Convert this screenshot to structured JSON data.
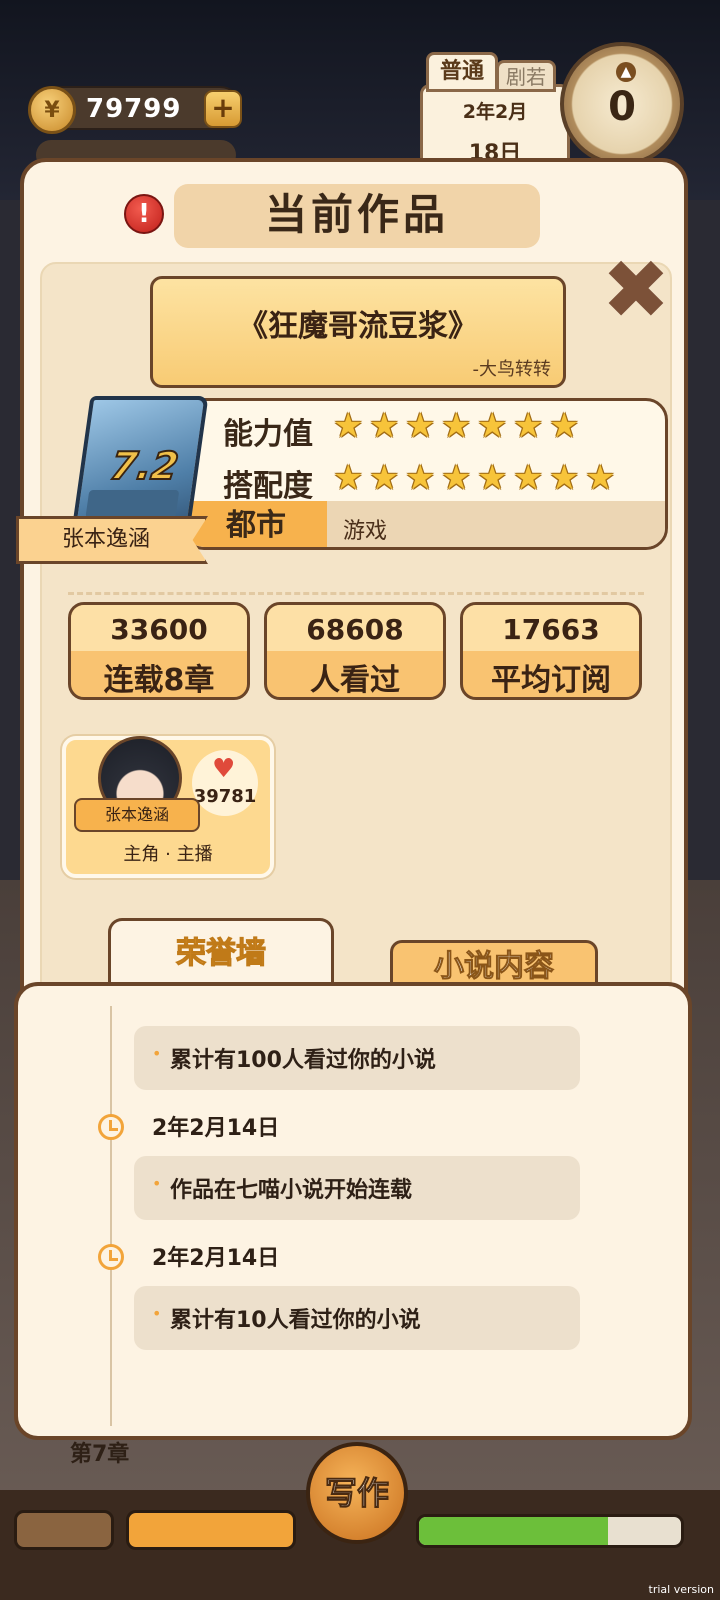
{
  "hud": {
    "coins": "79799",
    "coin_add_label": "+",
    "coin_symbol": "¥",
    "mode_tag": "普通",
    "mode_tag_2": "剧若",
    "date_month": "2年2月",
    "date_day": "18日",
    "clock_value": "0"
  },
  "popup": {
    "title": "当前作品",
    "alert_label": "!",
    "close_label": "✖",
    "book_title": "《狂魔哥流豆浆》",
    "book_author": "-大鸟转转",
    "cover_score": "7.2",
    "author_name": "张本逸涵",
    "ability_label": "能力值",
    "ability_stars": 7,
    "match_label": "搭配度",
    "match_stars": 8,
    "genre_main": "都市",
    "genre_sub": "游戏"
  },
  "metrics": [
    {
      "value": "33600",
      "label": "连载8章"
    },
    {
      "value": "68608",
      "label": "人看过"
    },
    {
      "value": "17663",
      "label": "平均订阅"
    }
  ],
  "character": {
    "name": "张本逸涵",
    "likes": "39781",
    "role": "主角 · 主播",
    "heart_icon": "heart-icon"
  },
  "tabs": {
    "honor": "荣誉墙",
    "novel": "小说内容"
  },
  "honor_wall": [
    {
      "type": "event",
      "text": "累计有100人看过你的小说"
    },
    {
      "type": "date",
      "text": "2年2月14日"
    },
    {
      "type": "event",
      "text": "作品在七喵小说开始连载"
    },
    {
      "type": "date",
      "text": "2年2月14日"
    },
    {
      "type": "event",
      "text": "累计有10人看过你的小说"
    }
  ],
  "bottom": {
    "chapter": "第7章",
    "write_label": "写作",
    "progress_fraction": 0.72
  },
  "watermark": "trial version",
  "colors": {
    "accent_orange": "#f2a43a",
    "panel_border": "#6a4529",
    "star_gold": "#f7c43a"
  }
}
